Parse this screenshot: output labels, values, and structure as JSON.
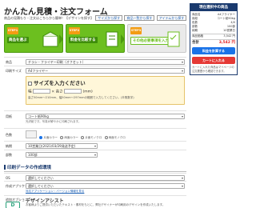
{
  "header": {
    "title": "かんたん見積・注文フォーム",
    "note": "商品の見積もり・注文はこちらから簡単！【デザインを探す】",
    "links": [
      "サイズから探す",
      "商品一覧から探す",
      "アイテムから探す"
    ]
  },
  "steps": [
    {
      "tag": "STEP1",
      "label": "商品を選ぶ"
    },
    {
      "tag": "STEP2",
      "label": "料金を比較する"
    },
    {
      "tag": "STEP3",
      "label": "その他必要事項を入力"
    }
  ],
  "form": {
    "product": {
      "label": "商品",
      "value": "チラシ・フライヤー印刷（オフセット）"
    },
    "size": {
      "label": "印刷サイズ",
      "value": "A4フライヤー"
    },
    "custom": {
      "title": "サイズを入力ください",
      "w_label": "幅",
      "h_label": "高さ",
      "unit": "(mm)",
      "note": "高さ50mm〜210mm、幅50mm〜297mmの範囲で入力してください。(半角数字)"
    },
    "paper": {
      "label": "用紙",
      "value": "コート紙90kg",
      "hint": "光沢紙です。写真が鮮やかに印刷されます。"
    },
    "color": {
      "label": "色数",
      "options": [
        "片面カラー",
        "両面カラー",
        "片面モノクロ",
        "両面モノクロ"
      ]
    },
    "delivery": {
      "label": "納期",
      "value": "10営業日(2021/03/29発送予定)"
    },
    "qty": {
      "label": "部数",
      "value": "100部"
    }
  },
  "print_data": {
    "heading": "印刷データの作成環境",
    "os": {
      "label": "OS",
      "value": "選択してください"
    },
    "app": {
      "label": "作成アプリケーション",
      "value": "選択してください",
      "link": "対応アプリケーション・バージョン情報を見る"
    }
  },
  "options": {
    "label": "追加オプション",
    "title": "デザインアシスト",
    "desc": "お客様よりご提供いただいたテキスト・素材をもとに、弊社デザイナーが印刷用のデザインを作成いたします。"
  },
  "sidebar": {
    "heading": "現在選択中の商品",
    "rows": [
      {
        "k": "商品名",
        "v": "A4フライヤー"
      },
      {
        "k": "用紙",
        "v": "コート紙90kg"
      },
      {
        "k": "色数",
        "v": "4/0"
      },
      {
        "k": "部数",
        "v": "100部"
      },
      {
        "k": "納期",
        "v": "10営業日"
      }
    ],
    "subtotal_label": "商品価格",
    "subtotal": "3,542 円",
    "total_label": "合計",
    "total": "3,542 円",
    "save_label": "料金を計算する",
    "cart_label": "カートに入れる",
    "note": "カートに入れた商品はマイページの注文履歴から確認できます。"
  },
  "colors": {
    "green": "#6cbf1f",
    "navy": "#1a3a6e",
    "red": "#e53935",
    "blue": "#1a73e8"
  }
}
